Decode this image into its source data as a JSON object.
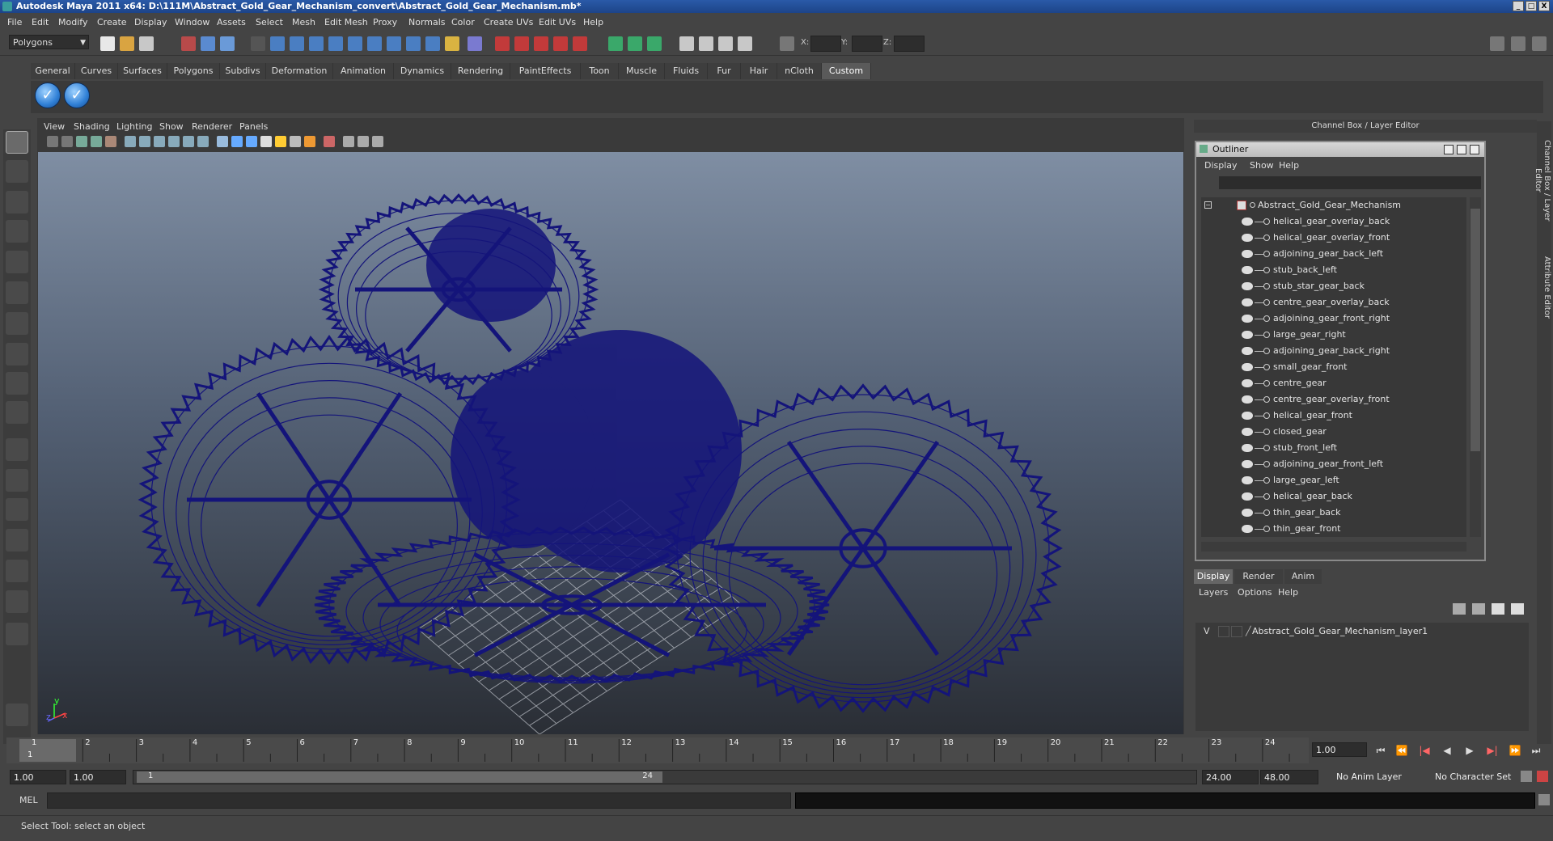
{
  "window": {
    "title": "Autodesk Maya 2011 x64: D:\\111M\\Abstract_Gold_Gear_Mechanism_convert\\Abstract_Gold_Gear_Mechanism.mb*",
    "buttons": [
      "_",
      "□",
      "X"
    ]
  },
  "menubar": [
    "File",
    "Edit",
    "Modify",
    "Create",
    "Display",
    "Window",
    "Assets",
    "Select",
    "Mesh",
    "Edit Mesh",
    "Proxy",
    "Normals",
    "Color",
    "Create UVs",
    "Edit UVs",
    "Help"
  ],
  "statusline": {
    "mode": "Polygons",
    "x_label": "X:",
    "y_label": "Y:",
    "z_label": "Z:"
  },
  "shelf": {
    "tabs": [
      "General",
      "Curves",
      "Surfaces",
      "Polygons",
      "Subdivs",
      "Deformation",
      "Animation",
      "Dynamics",
      "Rendering",
      "PaintEffects",
      "Toon",
      "Muscle",
      "Fluids",
      "Fur",
      "Hair",
      "nCloth",
      "Custom"
    ],
    "active_tab": "Custom",
    "check_glyph": "✓"
  },
  "viewport": {
    "menu": [
      "View",
      "Shading",
      "Lighting",
      "Show",
      "Renderer",
      "Panels"
    ],
    "axis_y": "y",
    "axis_x": "x",
    "axis_z": "z",
    "wire_color": "#14147a",
    "gradient_top": "#7f8ea3",
    "gradient_bottom": "#2a2e35"
  },
  "channel_box": {
    "header": "Channel Box / Layer Editor"
  },
  "outliner": {
    "title": "Outliner",
    "menu": [
      "Display",
      "Show",
      "Help"
    ],
    "root": "Abstract_Gold_Gear_Mechanism",
    "expand_glyph": "−",
    "items": [
      "helical_gear_overlay_back",
      "helical_gear_overlay_front",
      "adjoining_gear_back_left",
      "stub_back_left",
      "stub_star_gear_back",
      "centre_gear_overlay_back",
      "adjoining_gear_front_right",
      "large_gear_right",
      "adjoining_gear_back_right",
      "small_gear_front",
      "centre_gear",
      "centre_gear_overlay_front",
      "helical_gear_front",
      "closed_gear",
      "stub_front_left",
      "adjoining_gear_front_left",
      "large_gear_left",
      "helical_gear_back",
      "thin_gear_back",
      "thin_gear_front"
    ]
  },
  "layer_editor": {
    "tabs": [
      "Display",
      "Render",
      "Anim"
    ],
    "active_tab": "Display",
    "menu": [
      "Layers",
      "Options",
      "Help"
    ],
    "layer_visibility": "V",
    "layer_name": "Abstract_Gold_Gear_Mechanism_layer1"
  },
  "side_tabs": [
    "Channel Box / Layer Editor",
    "Attribute Editor"
  ],
  "time_slider": {
    "ticks": [
      "1",
      "2",
      "3",
      "4",
      "5",
      "6",
      "7",
      "8",
      "9",
      "10",
      "11",
      "12",
      "13",
      "14",
      "15",
      "16",
      "17",
      "18",
      "19",
      "20",
      "21",
      "22",
      "23",
      "24"
    ],
    "current_frame_marker": "1",
    "current_time": "1.00",
    "playback_glyphs": [
      "⏮",
      "⏪",
      "|◀",
      "◀",
      "▶",
      "▶|",
      "⏩",
      "⏭"
    ]
  },
  "range_slider": {
    "start_time": "1.00",
    "playback_start": "1.00",
    "range_start_label": "1",
    "range_end_label": "24",
    "playback_end": "24.00",
    "end_time": "48.00",
    "anim_layer": "No Anim Layer",
    "character_set": "No Character Set"
  },
  "command_line": {
    "label": "MEL"
  },
  "help_line": "Select Tool: select an object"
}
